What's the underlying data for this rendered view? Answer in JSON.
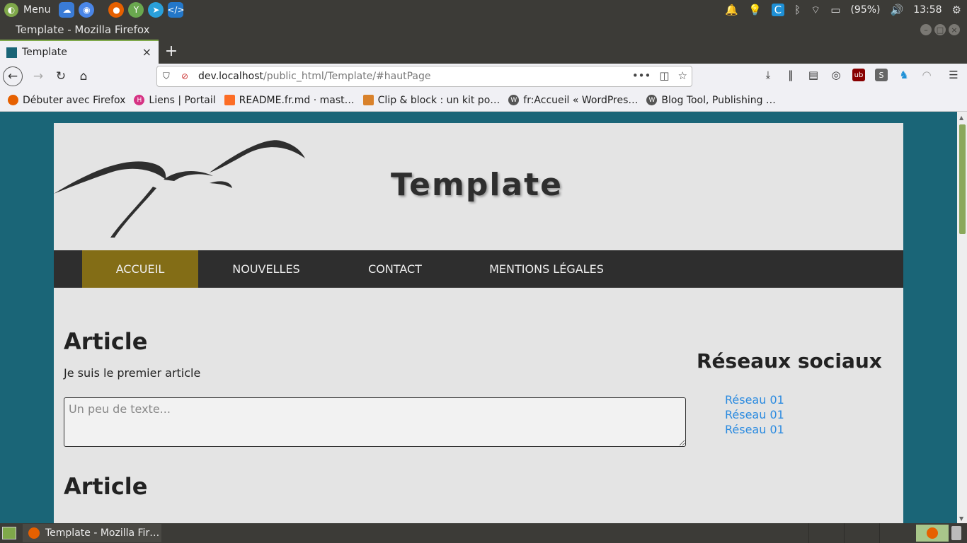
{
  "os_panel": {
    "menu_label": "Menu",
    "battery": "(95%)",
    "clock": "13:58",
    "launchers": [
      "files-icon",
      "chromium-icon",
      "firefox-icon",
      "yarn-icon",
      "telegram-icon",
      "vscode-icon"
    ]
  },
  "window": {
    "title": "Template - Mozilla Firefox"
  },
  "tab": {
    "title": "Template",
    "close": "×",
    "new_tab": "+"
  },
  "url": {
    "host": "dev.localhost",
    "path": "/public_html/Template/#hautPage",
    "more": "•••"
  },
  "bookmarks": [
    {
      "label": "Débuter avec Firefox",
      "icon": "firefox-icon",
      "color": "#e66000"
    },
    {
      "label": "Liens | Portail",
      "icon": "h-icon",
      "color": "#d63384"
    },
    {
      "label": "README.fr.md · mast…",
      "icon": "gitlab-icon",
      "color": "#fc6d26"
    },
    {
      "label": "Clip & block : un kit po…",
      "icon": "clip-icon",
      "color": "#d9822b"
    },
    {
      "label": "fr:Accueil « WordPres…",
      "icon": "wordpress-icon",
      "color": "#555555"
    },
    {
      "label": "Blog Tool, Publishing …",
      "icon": "wordpress-icon",
      "color": "#555555"
    }
  ],
  "site": {
    "title": "Template",
    "nav": [
      "ACCUEIL",
      "NOUVELLES",
      "CONTACT",
      "MENTIONS LÉGALES"
    ],
    "articles": [
      {
        "title": "Article",
        "text": "Je suis le premier article"
      },
      {
        "title": "Article"
      }
    ],
    "comment_placeholder": "Un peu de texte...",
    "aside": {
      "title": "Réseaux sociaux",
      "links": [
        "Réseau 01",
        "Réseau 01",
        "Réseau 01"
      ]
    }
  },
  "taskbar": {
    "task_label": "Template - Mozilla Fir…"
  },
  "colors": {
    "page_bg": "#1a6577",
    "nav_active": "#836d16",
    "link": "#2c8be0"
  }
}
